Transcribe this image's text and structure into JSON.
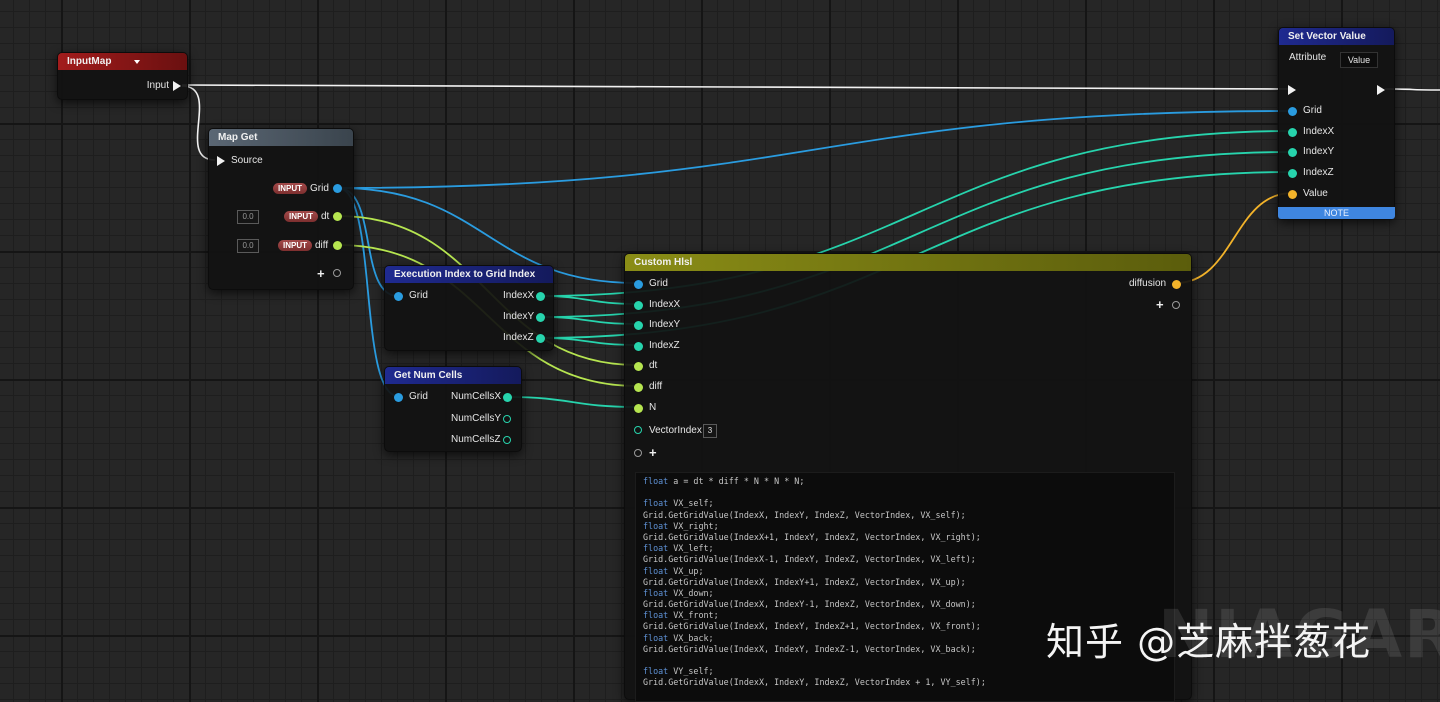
{
  "colors": {
    "grid_pin": "#2a9ce0",
    "int_pin": "#27d4ad",
    "float_pin": "#b6e550",
    "vector_pin": "#f3b32a",
    "exec_wire": "#f2f2f2",
    "input_header": "#8f1a1a",
    "getter_header": "#4d5a66",
    "function_header": "#1a1f7a",
    "custom_header": "#7c7f12"
  },
  "input_map": {
    "title": "InputMap",
    "input_label": "Input",
    "dropdown_icon": "triangle-down-icon"
  },
  "map_get": {
    "title": "Map Get",
    "source_label": "Source",
    "rows": [
      {
        "badge": "INPUT",
        "label": "Grid"
      },
      {
        "badge": "INPUT",
        "label": "dt",
        "default": "0.0"
      },
      {
        "badge": "INPUT",
        "label": "diff",
        "default": "0.0"
      }
    ]
  },
  "exec_index": {
    "title": "Execution Index to Grid Index",
    "input": "Grid",
    "outputs": [
      "IndexX",
      "IndexY",
      "IndexZ"
    ]
  },
  "num_cells": {
    "title": "Get Num Cells",
    "input": "Grid",
    "outputs": [
      "NumCellsX",
      "NumCellsY",
      "NumCellsZ"
    ]
  },
  "set_vector": {
    "title": "Set Vector Value",
    "attribute_label": "Attribute",
    "attribute_value": "Value",
    "inputs": [
      "Grid",
      "IndexX",
      "IndexY",
      "IndexZ",
      "Value"
    ],
    "note_button": "NOTE"
  },
  "custom_hlsl": {
    "title": "Custom Hlsl",
    "inputs": [
      "Grid",
      "IndexX",
      "IndexY",
      "IndexZ",
      "dt",
      "diff",
      "N"
    ],
    "vector_index_label": "VectorIndex",
    "vector_index_value": "3",
    "output": "diffusion",
    "code_lines": [
      "float a = dt * diff * N * N * N;",
      "",
      "float VX_self;",
      "Grid.GetGridValue(IndexX, IndexY, IndexZ, VectorIndex, VX_self);",
      "float VX_right;",
      "Grid.GetGridValue(IndexX+1, IndexY, IndexZ, VectorIndex, VX_right);",
      "float VX_left;",
      "Grid.GetGridValue(IndexX-1, IndexY, IndexZ, VectorIndex, VX_left);",
      "float VX_up;",
      "Grid.GetGridValue(IndexX, IndexY+1, IndexZ, VectorIndex, VX_up);",
      "float VX_down;",
      "Grid.GetGridValue(IndexX, IndexY-1, IndexZ, VectorIndex, VX_down);",
      "float VX_front;",
      "Grid.GetGridValue(IndexX, IndexY, IndexZ+1, VectorIndex, VX_front);",
      "float VX_back;",
      "Grid.GetGridValue(IndexX, IndexY, IndexZ-1, VectorIndex, VX_back);",
      "",
      "float VY_self;",
      "Grid.GetGridValue(IndexX, IndexY, IndexZ, VectorIndex + 1, VY_self);"
    ]
  },
  "watermark": {
    "text": "知乎 @芝麻拌葱花",
    "ghost": "NIAGARA"
  }
}
